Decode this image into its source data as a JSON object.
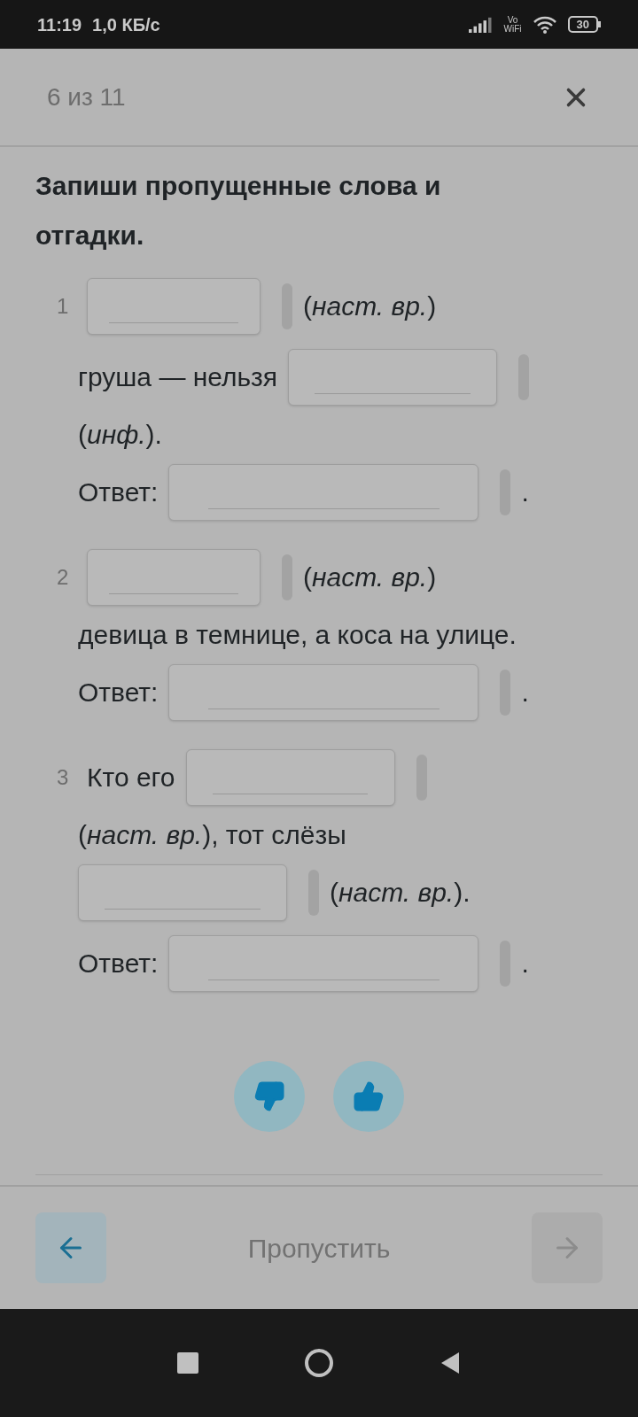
{
  "status_bar": {
    "time": "11:19",
    "speed": "1,0 КБ/с",
    "vo_wifi": [
      "Vo",
      "WiFi"
    ],
    "battery": "30"
  },
  "header": {
    "progress": "6 из 11"
  },
  "task": {
    "title": "Запиши пропущенные слова и отгадки."
  },
  "items": [
    {
      "number": "1",
      "parts": [
        {
          "kind": "blank"
        },
        {
          "kind": "text",
          "text": "(*наст. вр.*)"
        },
        {
          "kind": "text",
          "text": "груша — нельзя"
        },
        {
          "kind": "blank"
        },
        {
          "kind": "text",
          "text": "(*инф.*)."
        }
      ],
      "answer": {
        "label": "Ответ:",
        "end": "."
      }
    },
    {
      "number": "2",
      "parts": [
        {
          "kind": "blank"
        },
        {
          "kind": "text",
          "text": "(*наст. вр.*)"
        },
        {
          "kind": "text",
          "text": "девица в темнице, а коса на улице."
        }
      ],
      "answer": {
        "label": "Ответ:",
        "end": "."
      }
    },
    {
      "number": "3",
      "parts": [
        {
          "kind": "text",
          "text": "Кто его"
        },
        {
          "kind": "blank"
        },
        {
          "kind": "text",
          "text": "(*наст. вр.*), тот слёзы"
        },
        {
          "kind": "blank"
        },
        {
          "kind": "text",
          "text": "(*наст. вр.*)."
        }
      ],
      "answer": {
        "label": "Ответ:",
        "end": "."
      }
    }
  ],
  "footer": {
    "skip": "Пропустить",
    "next_disabled": true
  }
}
